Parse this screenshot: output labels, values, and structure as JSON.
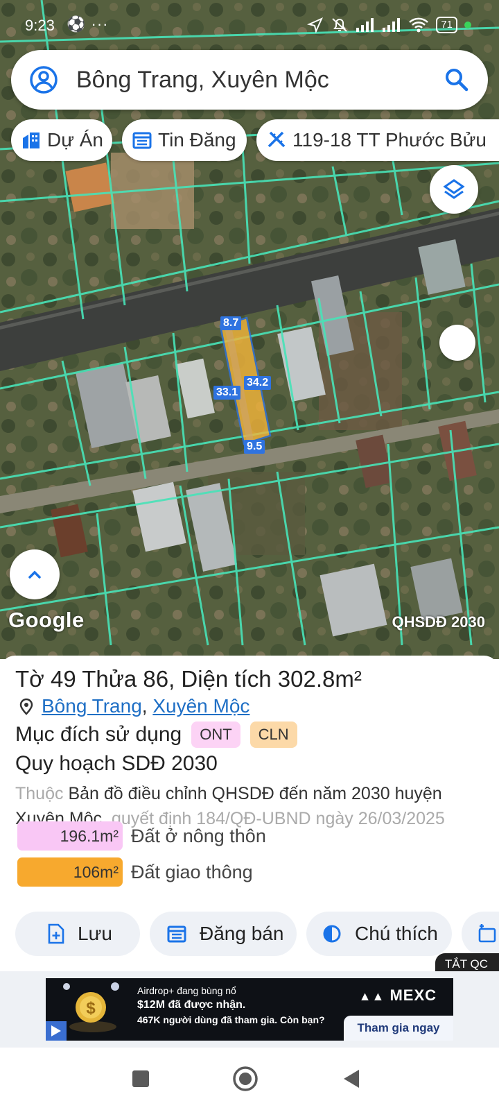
{
  "status_bar": {
    "time": "9:23",
    "extra": "⚽ ···",
    "battery": "71"
  },
  "search": {
    "query": "Bông Trang, Xuyên Mộc"
  },
  "chips": [
    {
      "label": "Dự Án",
      "icon": "building-icon"
    },
    {
      "label": "Tin Đăng",
      "icon": "calendar-list-icon"
    },
    {
      "label": "119-18 TT Phước Bửu",
      "icon": "ruler-pencil-icon"
    }
  ],
  "map": {
    "logo": "Google",
    "layer_label": "QHSDĐ 2030",
    "dimensions": {
      "top": "8.7",
      "left": "33.1",
      "right": "34.2",
      "bottom": "9.5"
    },
    "accent": "#48e3b8",
    "parcel_color": "#f4b53a"
  },
  "parcel": {
    "title": "Tờ 49 Thửa 86, Diện tích 302.8m²",
    "location_parts": [
      "Bông Trang",
      "Xuyên Mộc"
    ],
    "location_separator": ", ",
    "purpose_label": "Mục đích sử dụng",
    "tags": [
      {
        "label": "ONT",
        "color": "#fcd3f5"
      },
      {
        "label": "CLN",
        "color": "#fcd9a8"
      }
    ],
    "plan_title": "Quy hoạch SDĐ 2030",
    "plan_prefix": "Thuộc",
    "plan_name": "Bản đồ điều chỉnh QHSDĐ đến năm 2030 huyện Xuyên Mộc",
    "plan_suffix": ", quyết định 184/QĐ-UBND ngày 26/03/2025",
    "areas": [
      {
        "value": "196.1m²",
        "label": "Đất ở nông thôn",
        "color": "#f9c7f5"
      },
      {
        "value": "106m²",
        "label": "Đất giao thông",
        "color": "#f7a92e"
      }
    ]
  },
  "actions": [
    {
      "label": "Lưu",
      "icon": "file-plus-icon"
    },
    {
      "label": "Đăng bán",
      "icon": "calendar-list-icon"
    },
    {
      "label": "Chú thích",
      "icon": "contrast-icon"
    }
  ],
  "ad": {
    "close_label": "TẮT QC",
    "line1": "Airdrop+ đang bùng nổ",
    "line2": "$12M đã được nhận.",
    "line3": "467K người dùng đã tham gia. Còn bạn?",
    "brand": "MEXC",
    "cta": "Tham gia ngay"
  }
}
